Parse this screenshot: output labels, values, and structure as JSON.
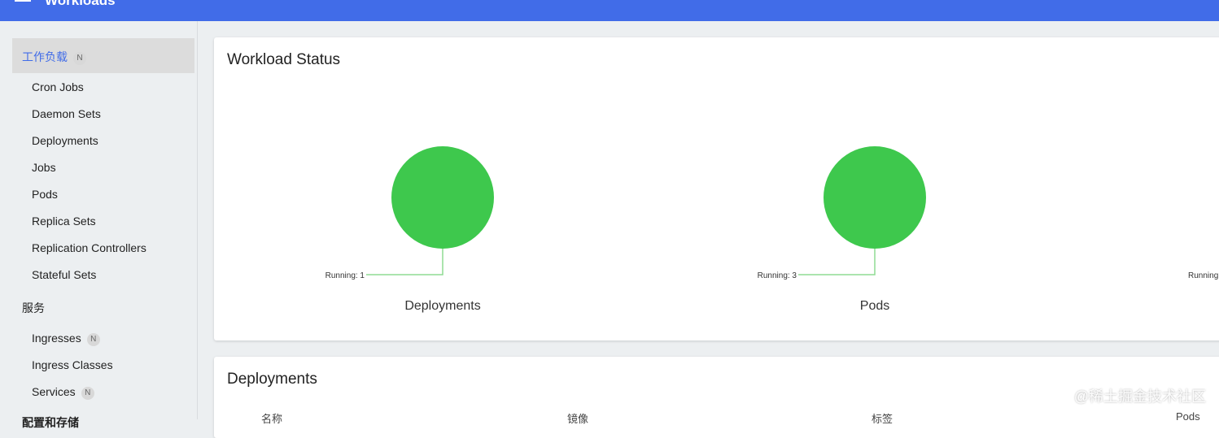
{
  "header": {
    "title": "Workloads"
  },
  "sidebar": {
    "active": {
      "label": "工作负载",
      "badge": "N"
    },
    "workload_items": [
      "Cron Jobs",
      "Daemon Sets",
      "Deployments",
      "Jobs",
      "Pods",
      "Replica Sets",
      "Replication Controllers",
      "Stateful Sets"
    ],
    "services_group": "服务",
    "service_items": [
      {
        "label": "Ingresses",
        "badge": "N"
      },
      {
        "label": "Ingress Classes",
        "badge": ""
      },
      {
        "label": "Services",
        "badge": "N"
      }
    ],
    "next_group": "配置和存储"
  },
  "status_card": {
    "title": "Workload Status",
    "charts": [
      {
        "title": "Deployments",
        "label": "Running: 1",
        "color": "#3ec84d"
      },
      {
        "title": "Pods",
        "label": "Running: 3",
        "color": "#3ec84d"
      },
      {
        "label": "Running"
      }
    ]
  },
  "deployments_card": {
    "title": "Deployments",
    "columns": [
      "名称",
      "镜像",
      "标签",
      "Pods"
    ]
  },
  "watermark": "@稀土掘金技术社区",
  "chart_data": [
    {
      "type": "pie",
      "title": "Deployments",
      "categories": [
        "Running"
      ],
      "values": [
        1
      ]
    },
    {
      "type": "pie",
      "title": "Pods",
      "categories": [
        "Running"
      ],
      "values": [
        3
      ]
    }
  ]
}
